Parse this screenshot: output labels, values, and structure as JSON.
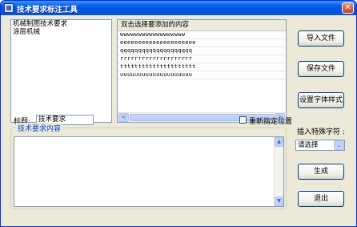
{
  "window": {
    "title": "技术要求标注工具",
    "close_glyph": "✕"
  },
  "source_list": {
    "items": [
      "机械制图技术要求",
      "涂层机械"
    ]
  },
  "content_grid": {
    "header": "双击选择要添加的内容",
    "rows": [
      "wwwwwwwwwwwwwwwwww",
      "eeeeeeeeeeeeeeeeeeeee",
      "qqqqqqqqqqqqqqqqqqqq",
      "rrrrrrrrrrrrrrrrrrrr",
      "ttttttttttttttttttttt",
      "uuuuuuuuuuuuuuuuuuuu"
    ],
    "scroll_left": "<",
    "scroll_right": ">"
  },
  "buttons": {
    "import_file": "导入文件",
    "save_file": "保存文件",
    "font_style": "设置字体样式",
    "generate": "生成",
    "exit": "退出"
  },
  "title_field": {
    "label": "标题:",
    "value": "技术要求"
  },
  "reposition": {
    "label": "重新指定位置",
    "checked": false
  },
  "content_group": {
    "legend": "技术要求内容",
    "value": "",
    "scroll_up": "▲",
    "scroll_down": "▼"
  },
  "special_char": {
    "label": "插入特殊字符 :",
    "selected": "请选择",
    "arrow": "⌄"
  }
}
